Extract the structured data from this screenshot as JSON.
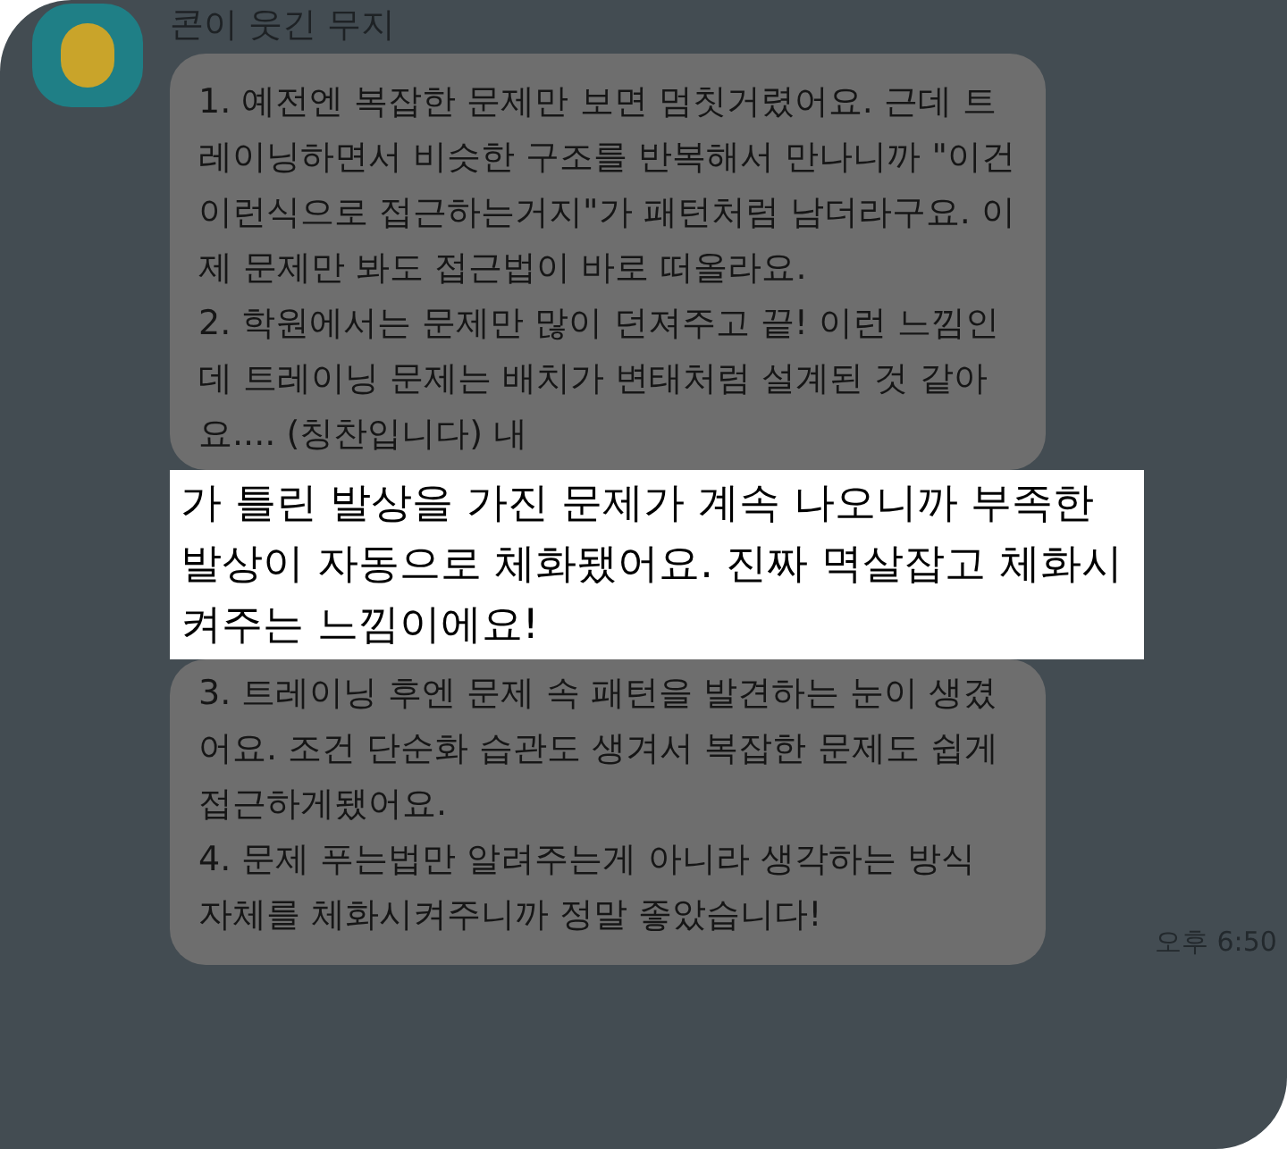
{
  "sender": {
    "name": "콘이 웃긴 무지"
  },
  "message": {
    "before": [
      "1. 예전엔 복잡한 문제만 보면 멈칫거렸어요. 근데 트레이닝하면서 비슷한 구조를 반복해서 만나니까 \"이건 이런식으로 접근하는거지\"가 패턴처럼 남더라구요. 이제 문제만 봐도 접근법이 바로 떠올라요.",
      "2. 학원에서는 문제만 많이 던져주고 끝! 이런 느낌인데 트레이닝 문제는 배치가 변태처럼 설계된 것 같아요.... (칭찬입니다) 내"
    ],
    "highlight": "가 틀린 발상을 가진 문제가 계속 나오니까 부족한 발상이 자동으로 체화됐어요. 진짜 멱살잡고 체화시켜주는 느낌이에요!",
    "after": [
      "3. 트레이닝 후엔 문제 속 패턴을 발견하는 눈이 생겼어요. 조건 단순화 습관도 생겨서 복잡한 문제도 쉽게 접근하게됐어요.",
      "4. 문제 푸는법만 알려주는게 아니라 생각하는 방식 자체를 체화시켜주니까 정말 좋았습니다!"
    ],
    "time": "오후 6:50"
  }
}
